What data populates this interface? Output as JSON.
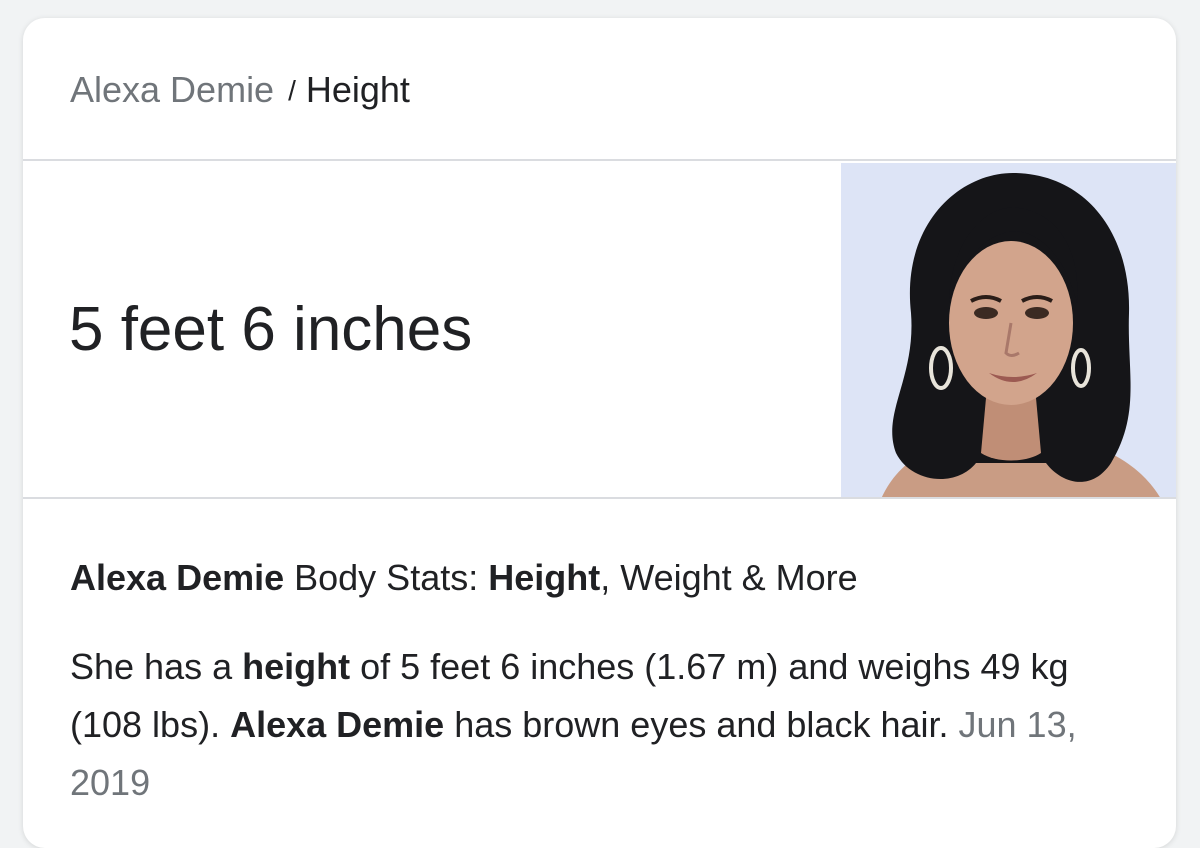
{
  "breadcrumb": {
    "parent": "Alexa Demie",
    "separator": "/",
    "current": "Height"
  },
  "answer": {
    "value": "5 feet 6 inches"
  },
  "portrait": {
    "icon": "person-portrait-photo"
  },
  "snippet": {
    "title": {
      "name": "Alexa Demie",
      "text1": " Body Stats: ",
      "bold2": "Height",
      "text2": ", Weight & More"
    },
    "body": {
      "t1": "She has a ",
      "b1": "height",
      "t2": " of 5 feet 6 inches (1.67 m) and weighs 49 kg (108 lbs). ",
      "b2": "Alexa Demie",
      "t3": " has brown eyes and black hair.",
      "date": "Jun 13, 2019"
    }
  },
  "colors": {
    "primary_text": "#202124",
    "secondary_text": "#70757a",
    "divider": "#dadce0",
    "photo_background": "#dde4f6"
  }
}
